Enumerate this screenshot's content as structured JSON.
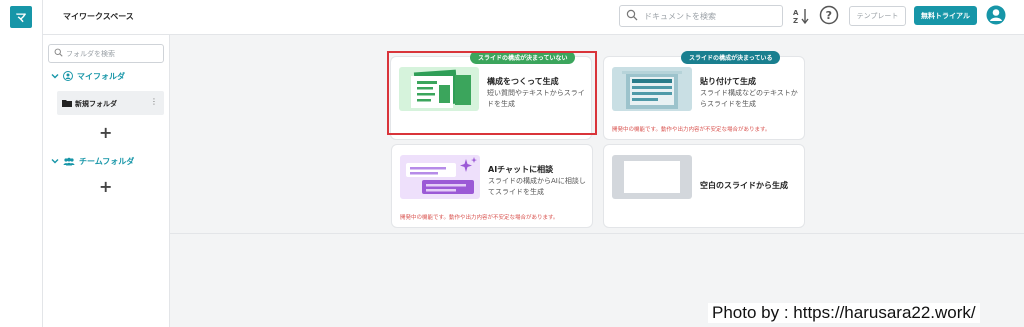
{
  "app": {
    "logo_letter": "マ",
    "workspace_title": "マイワークスペース"
  },
  "header": {
    "search_placeholder": "ドキュメントを検索",
    "template_button": "テンプレート",
    "trial_button": "無料トライアル"
  },
  "sidebar": {
    "folder_search_placeholder": "フォルダを検索",
    "my_folder_label": "マイフォルダ",
    "folders": [
      {
        "label": "新規フォルダ"
      }
    ],
    "team_folder_label": "チームフォルダ",
    "add_glyph": "+"
  },
  "cards": [
    {
      "badge": "スライドの構成が決まっていない",
      "title": "構成をつくって生成",
      "desc": "短い質問やテキストからスライドを生成",
      "warning": ""
    },
    {
      "badge": "スライドの構成が決まっている",
      "title": "貼り付けて生成",
      "desc": "スライド構成などのテキストからスライドを生成",
      "warning": "開発中の機能です。動作や出力内容が不安定な場合があります。"
    },
    {
      "badge": "",
      "title": "AIチャットに相談",
      "desc": "スライドの構成からAIに相談してスライドを生成",
      "warning": "開発中の機能です。動作や出力内容が不安定な場合があります。"
    },
    {
      "badge": "",
      "title": "空白のスライドから生成",
      "desc": "",
      "warning": ""
    }
  ],
  "credit": "Photo by : https://harusara22.work/",
  "colors": {
    "accent": "#1796a8",
    "green": "#3ba55c",
    "teal_dark": "#1a7f8f",
    "highlight": "#d9343a",
    "warning": "#d9534f"
  },
  "icons": [
    "search-icon",
    "sort-az-icon",
    "help-icon",
    "avatar-icon",
    "chevron-down-icon",
    "user-icon",
    "team-icon",
    "folder-icon",
    "kebab-icon",
    "plus-icon"
  ]
}
